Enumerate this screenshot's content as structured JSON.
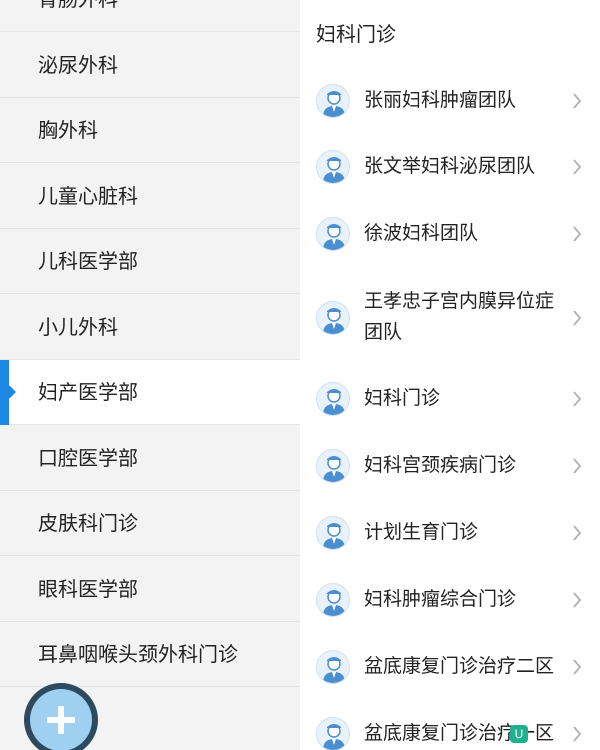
{
  "sidebar": {
    "items": [
      {
        "label": "胃肠外科"
      },
      {
        "label": "泌尿外科"
      },
      {
        "label": "胸外科"
      },
      {
        "label": "儿童心脏科"
      },
      {
        "label": "儿科医学部"
      },
      {
        "label": "小儿外科"
      },
      {
        "label": "妇产医学部"
      },
      {
        "label": "口腔医学部"
      },
      {
        "label": "皮肤科门诊"
      },
      {
        "label": "眼科医学部"
      },
      {
        "label": "耳鼻咽喉头颈外科门诊"
      },
      {
        "label": ""
      }
    ],
    "active_index": 6,
    "accent_color": "#1e88e5"
  },
  "content": {
    "title": "妇科门诊",
    "rows": [
      {
        "name": "张丽妇科肿瘤团队"
      },
      {
        "name": "张文举妇科泌尿团队"
      },
      {
        "name": "徐波妇科团队"
      },
      {
        "name": "王孝忠子宫内膜异位症团队"
      },
      {
        "name": "妇科门诊"
      },
      {
        "name": "妇科宫颈疾病门诊"
      },
      {
        "name": "计划生育门诊"
      },
      {
        "name": "妇科肿瘤综合门诊"
      },
      {
        "name": "盆底康复门诊治疗二区"
      },
      {
        "name": "盆底康复门诊治疗一区"
      }
    ],
    "avatar_icon": "doctor-avatar-icon",
    "chevron_icon": "chevron-right-icon"
  },
  "fab": {
    "icon": "plus-icon"
  },
  "corner_badge": {
    "text": "U"
  }
}
